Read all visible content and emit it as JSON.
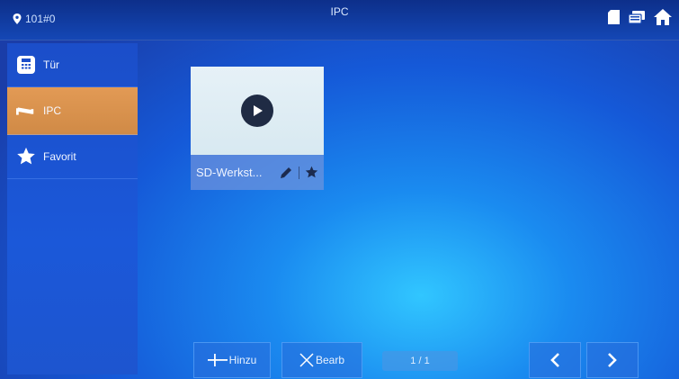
{
  "header": {
    "location": "101#0",
    "title": "IPC",
    "icons": [
      "sd-card-icon",
      "display-icon",
      "home-icon"
    ]
  },
  "sidebar": {
    "items": [
      {
        "label": "Tür",
        "icon": "keypad-icon",
        "active": false
      },
      {
        "label": "IPC",
        "icon": "camera-icon",
        "active": true
      },
      {
        "label": "Favorit",
        "icon": "star-icon",
        "active": false
      }
    ]
  },
  "main": {
    "camera_card": {
      "name": "SD-Werkst...",
      "icons": [
        "play-icon",
        "edit-icon",
        "star-icon"
      ]
    }
  },
  "footer": {
    "add_label": "Hinzu",
    "edit_label": "Bearb",
    "page_indicator": "1 / 1"
  },
  "colors": {
    "active_item": "#d8914d",
    "background": "#1a5bd9"
  }
}
